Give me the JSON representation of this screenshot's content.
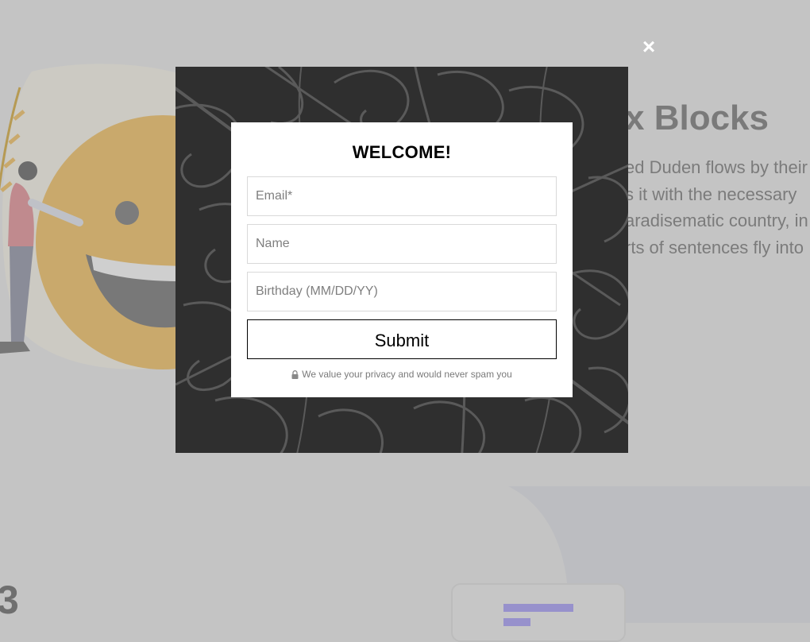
{
  "background": {
    "heading": "x Blocks",
    "paragraph_lines": [
      "ed Duden flows by their",
      "s it with the necessary",
      "aradisematic country, in",
      "rts of sentences fly into"
    ],
    "partial_digit": "3"
  },
  "modal": {
    "title": "WELCOME!",
    "fields": {
      "email_placeholder": "Email*",
      "name_placeholder": "Name",
      "birthday_placeholder": "Birthday (MM/DD/YY)"
    },
    "submit_label": "Submit",
    "privacy_note": "We value your privacy and would never spam you",
    "close_glyph": "×"
  },
  "colors": {
    "overlay": "#c4c4c4",
    "modal_frame": "#2f2f2f",
    "accent_bar": "#9791cc"
  },
  "icons": [
    "close-icon",
    "lock-icon"
  ]
}
